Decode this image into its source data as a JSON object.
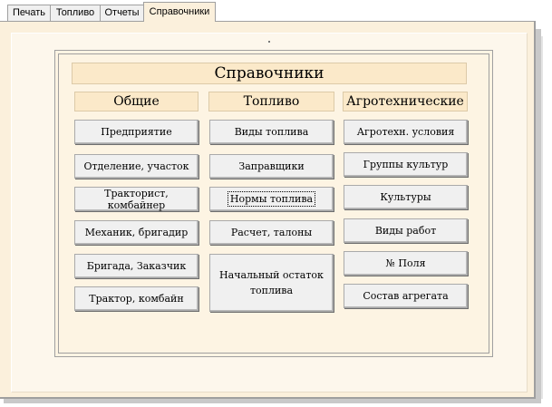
{
  "tabs": [
    {
      "label": "Печать"
    },
    {
      "label": "Топливо"
    },
    {
      "label": "Отчеты"
    },
    {
      "label": "Справочники",
      "active": true
    }
  ],
  "panel": {
    "title": "Справочники",
    "columns": [
      {
        "header": "Общие",
        "buttons": [
          "Предприятие",
          "Отделение, участок",
          "Тракторист, комбайнер",
          "Механик, бригадир",
          "Бригада, Заказчик",
          "Трактор, комбайн"
        ]
      },
      {
        "header": "Топливо",
        "buttons": [
          "Виды топлива",
          "Заправщики",
          "Нормы топлива",
          "Расчет, талоны",
          "Начальный остаток топлива"
        ],
        "focused_button": "Нормы топлива"
      },
      {
        "header": "Агротехнические",
        "buttons": [
          "Агротехн. условия",
          "Группы культур",
          "Культуры",
          "Виды работ",
          "№ Поля",
          "Состав агрегата"
        ]
      }
    ]
  },
  "colors": {
    "page_background": "#fbf0dc",
    "header_fill": "#fbe9c9",
    "button_face": "#f0f0f0"
  }
}
